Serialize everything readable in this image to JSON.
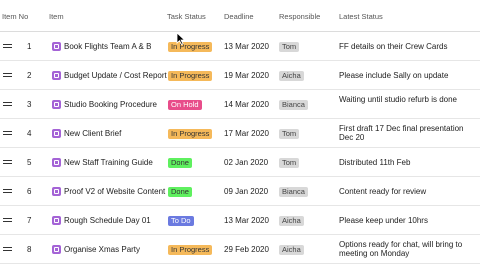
{
  "headers": {
    "item_no": "Item No",
    "item": "Item",
    "task_status": "Task Status",
    "deadline": "Deadline",
    "responsible": "Responsible",
    "latest_status": "Latest Status"
  },
  "colors": {
    "in_progress": "#f5b95a",
    "on_hold": "#e84d8a",
    "done": "#5ff05f",
    "to_do": "#6b7ae0",
    "item_icon": "#a463d6"
  },
  "rows": [
    {
      "no": "1",
      "item": "Book Flights Team A & B",
      "status": "In Progress",
      "status_key": "in_progress",
      "deadline": "13 Mar 2020",
      "responsible": "Tom",
      "latest": "FF details on their Crew Cards"
    },
    {
      "no": "2",
      "item": "Budget Update / Cost Report",
      "status": "In Progress",
      "status_key": "in_progress",
      "deadline": "19 Mar 2020",
      "responsible": "Aicha",
      "latest": "Please include Sally on update"
    },
    {
      "no": "3",
      "item": "Studio Booking Procedure",
      "status": "On Hold",
      "status_key": "on_hold",
      "deadline": "14 Mar 2020",
      "responsible": "Bianca",
      "latest": "Waiting until studio refurb is done"
    },
    {
      "no": "4",
      "item": "New Client Brief",
      "status": "In Progress",
      "status_key": "in_progress",
      "deadline": "17 Mar 2020",
      "responsible": "Tom",
      "latest": "First draft 17 Dec final presentation Dec 20"
    },
    {
      "no": "5",
      "item": "New Staff Training Guide",
      "status": "Done",
      "status_key": "done",
      "deadline": "02 Jan 2020",
      "responsible": "Tom",
      "latest": "Distributed 11th Feb"
    },
    {
      "no": "6",
      "item": "Proof V2 of Website Content",
      "status": "Done",
      "status_key": "done",
      "deadline": "09 Jan 2020",
      "responsible": "Bianca",
      "latest": "Content ready for review"
    },
    {
      "no": "7",
      "item": "Rough Schedule Day 01",
      "status": "To Do",
      "status_key": "to_do",
      "deadline": "13 Mar 2020",
      "responsible": "Aicha",
      "latest": "Please keep under 10hrs"
    },
    {
      "no": "8",
      "item": "Organise Xmas Party",
      "status": "In Progress",
      "status_key": "in_progress",
      "deadline": "29 Feb 2020",
      "responsible": "Aicha",
      "latest": "Options ready for chat, will bring to meeting on Monday"
    }
  ]
}
